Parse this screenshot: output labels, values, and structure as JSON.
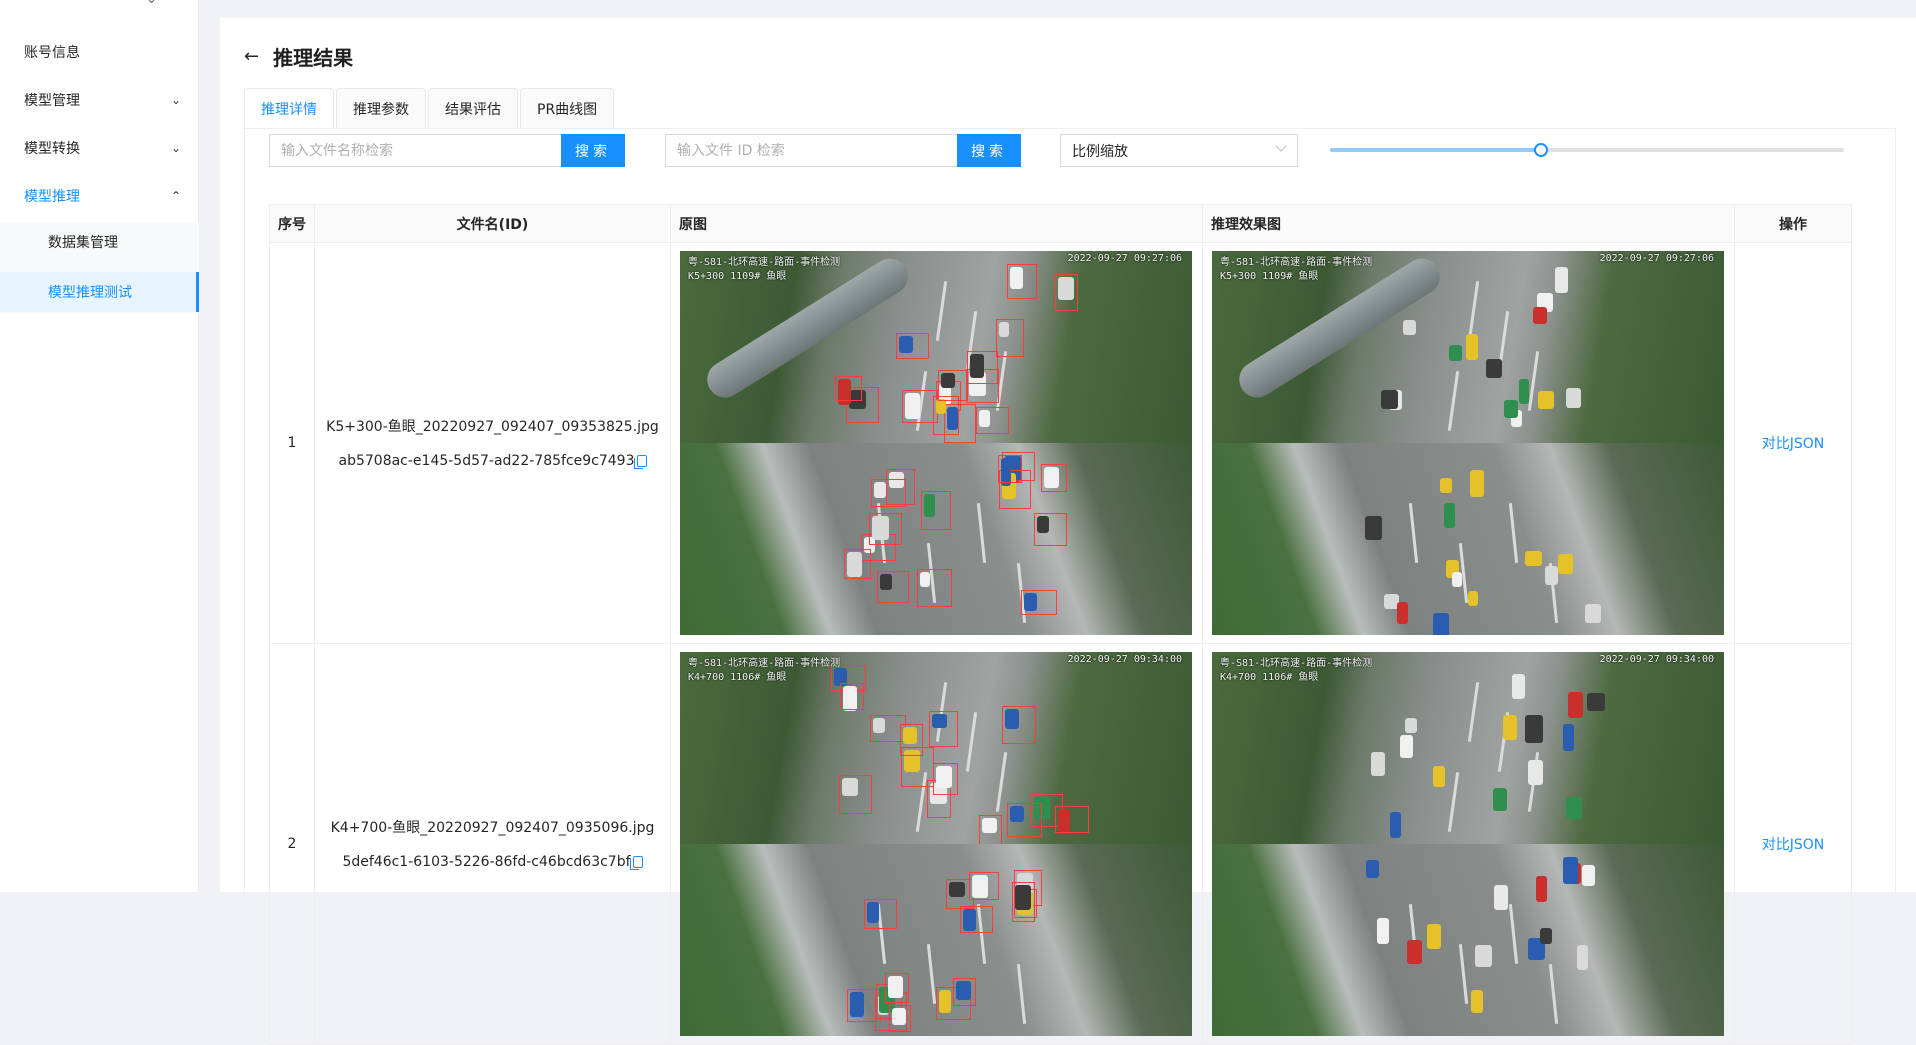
{
  "sidebar": {
    "items": [
      {
        "label": "账号信息",
        "icon": ""
      },
      {
        "label": "模型管理",
        "icon": "chevron-down-icon"
      },
      {
        "label": "模型转换",
        "icon": "chevron-down-icon"
      },
      {
        "label": "模型推理",
        "icon": "chevron-up-icon"
      }
    ],
    "subitems": [
      {
        "label": "数据集管理"
      },
      {
        "label": "模型推理测试"
      }
    ]
  },
  "page": {
    "title": "推理结果",
    "tabs": [
      "推理详情",
      "推理参数",
      "结果评估",
      "PR曲线图"
    ]
  },
  "search_name": {
    "placeholder": "输入文件名称检索",
    "button": "搜索"
  },
  "search_id": {
    "placeholder": "输入文件 ID 检索",
    "button": "搜索"
  },
  "scale_select": {
    "value": "比例缩放"
  },
  "scale_slider": {
    "value_fraction": 0.41
  },
  "table": {
    "headers": [
      "序号",
      "文件名(ID)",
      "原图",
      "推理效果图",
      "操作"
    ],
    "rows": [
      {
        "index": "1",
        "filename": "K5+300-鱼眼_20220927_092407_09353825.jpg",
        "file_id": "ab5708ac-e145-5d57-ad22-785fce9c7493",
        "action": "对比JSON",
        "osd_top_left": "粤-S81-北环高速-路面-事件检测",
        "osd_top_left2": "K5+300 1109# 鱼眼",
        "osd_top_right": "2022-09-27 09:27:06"
      },
      {
        "index": "2",
        "filename": "K4+700-鱼眼_20220927_092407_0935096.jpg",
        "file_id": "5def46c1-6103-5226-86fd-c46bcd63c7bf",
        "action": "对比JSON",
        "osd_top_left": "粤-S81-北环高速-路面-事件检测",
        "osd_top_left2": "K4+700 1106# 鱼眼",
        "osd_top_right": "2022-09-27 09:34:00"
      }
    ]
  },
  "colors": {
    "accent": "#1890ff",
    "box": "#ff3b3b"
  }
}
